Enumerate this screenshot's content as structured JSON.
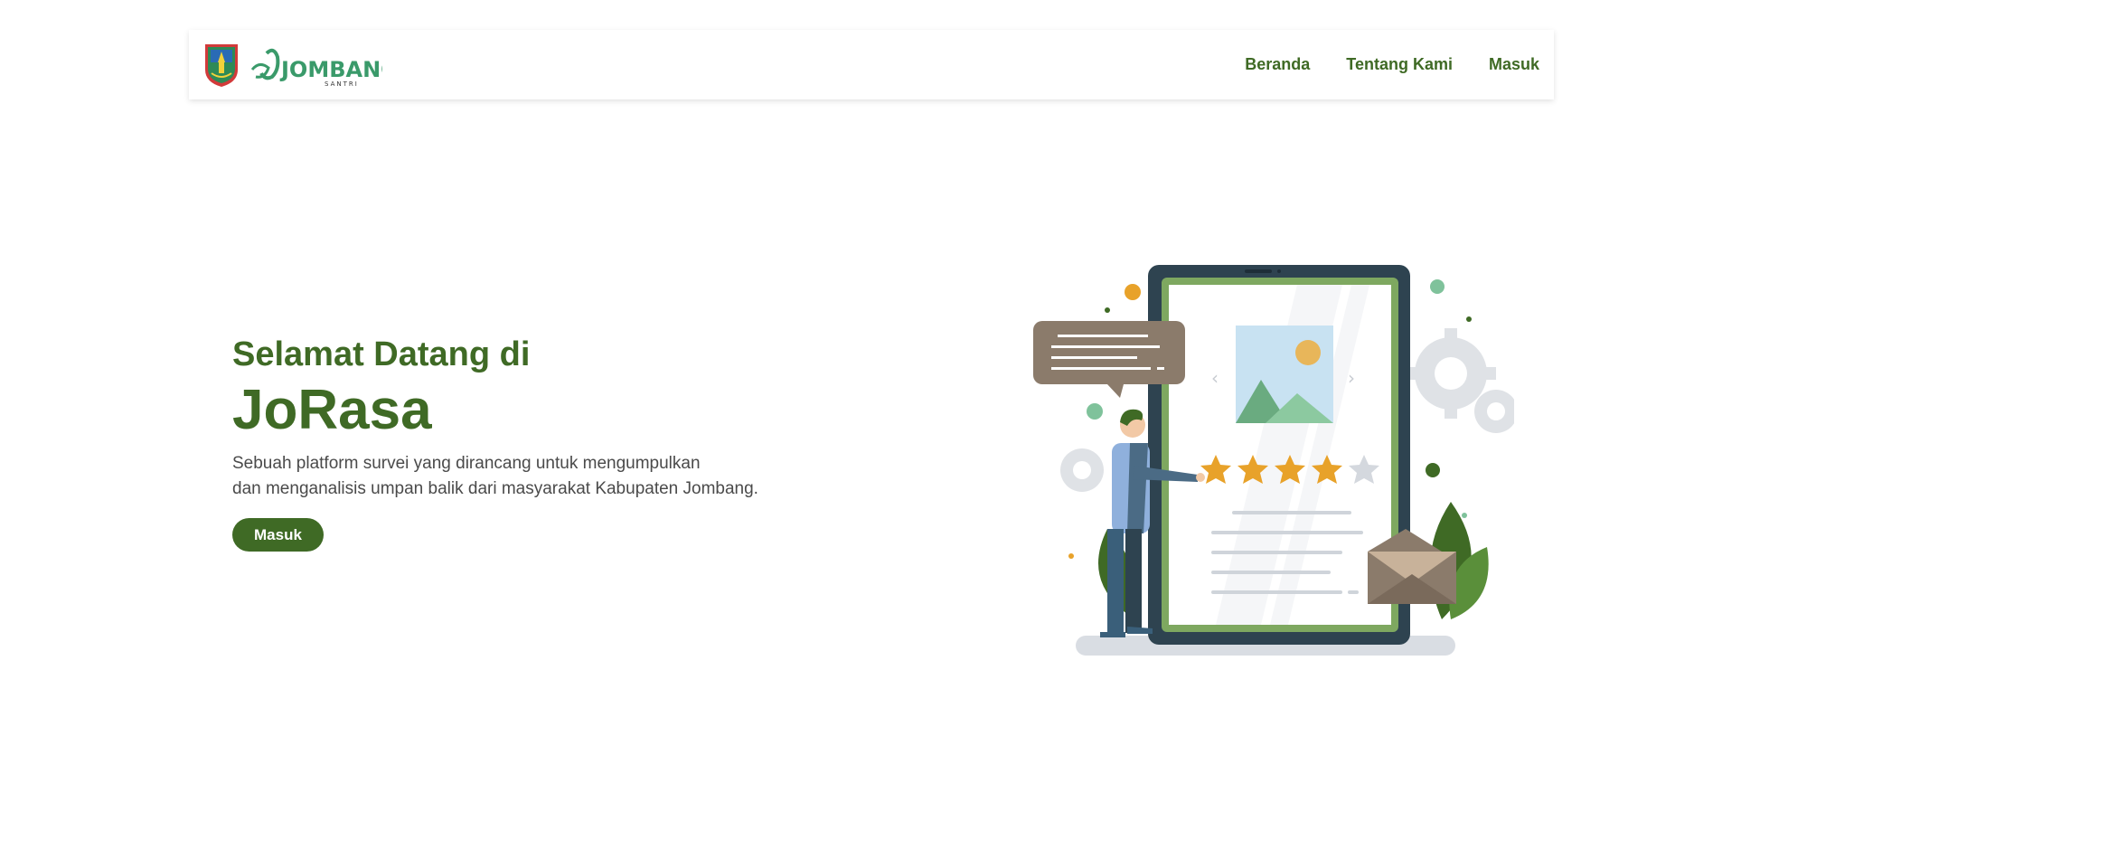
{
  "header": {
    "logo_text": "JOMBANG",
    "logo_subtext": "SANTRI",
    "nav": [
      {
        "label": "Beranda"
      },
      {
        "label": "Tentang Kami"
      },
      {
        "label": "Masuk"
      }
    ]
  },
  "hero": {
    "greeting": "Selamat Datang di",
    "title": "JoRasa",
    "description_line1": "Sebuah platform survei yang dirancang untuk mengumpulkan",
    "description_line2": "dan menganalisis umpan balik dari masyarakat Kabupaten Jombang.",
    "button_label": "Masuk"
  },
  "illustration": {
    "stars_filled": 4,
    "stars_total": 5
  },
  "colors": {
    "primary": "#3f6a25",
    "accent_orange": "#e8a22a",
    "tablet_dark": "#2e4350",
    "tablet_green": "#7ea860",
    "bubble_brown": "#8b7b6b"
  }
}
